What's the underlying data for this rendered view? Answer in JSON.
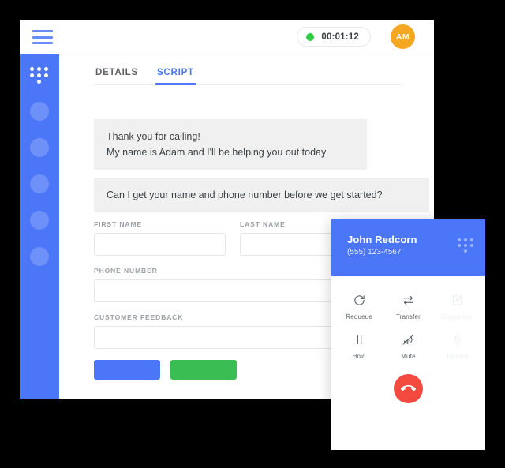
{
  "topbar": {
    "menu_icon": "hamburger-menu-icon",
    "timer": "00:01:12",
    "status_dot_color": "#2ecc40",
    "avatar_initials": "AM",
    "avatar_color": "#f5a623"
  },
  "rail": {
    "dialpad_icon": "dialpad-icon",
    "placeholder_count": 5,
    "color": "#4a76f7"
  },
  "tabs": [
    {
      "label": "DETAILS",
      "active": false
    },
    {
      "label": "SCRIPT",
      "active": true
    }
  ],
  "script": {
    "bubbles": [
      "Thank you for calling!\nMy name is Adam and I'll be helping you out today",
      "Can I get your name and phone number before we get started?"
    ]
  },
  "form": {
    "first_name": {
      "label": "FIRST NAME",
      "value": "",
      "placeholder": ""
    },
    "last_name": {
      "label": "LAST NAME",
      "value": "",
      "placeholder": ""
    },
    "phone_number": {
      "label": "PHONE NUMBER",
      "value": "",
      "placeholder": ""
    },
    "customer_feedback": {
      "label": "CUSTOMER FEEDBACK",
      "value": "",
      "placeholder": ""
    },
    "buttons": [
      {
        "label": "",
        "color": "#4a76f7",
        "name": "primary"
      },
      {
        "label": "",
        "color": "#3abe54",
        "name": "success"
      }
    ]
  },
  "call_panel": {
    "caller_name": "John Redcorn",
    "caller_phone": "(555) 123-4567",
    "dialpad_icon": "dialpad-icon",
    "header_color": "#4a76f7",
    "actions": [
      {
        "label": "Requeue",
        "icon": "requeue-icon",
        "disabled": false
      },
      {
        "label": "Transfer",
        "icon": "transfer-icon",
        "disabled": false
      },
      {
        "label": "Disposition",
        "icon": "disposition-icon",
        "disabled": true
      },
      {
        "label": "Hold",
        "icon": "hold-icon",
        "disabled": false
      },
      {
        "label": "Mute",
        "icon": "mute-icon",
        "disabled": false
      },
      {
        "label": "Record",
        "icon": "record-icon",
        "disabled": true
      }
    ],
    "hangup": {
      "icon": "hangup-phone-icon",
      "color": "#f3493f"
    }
  }
}
